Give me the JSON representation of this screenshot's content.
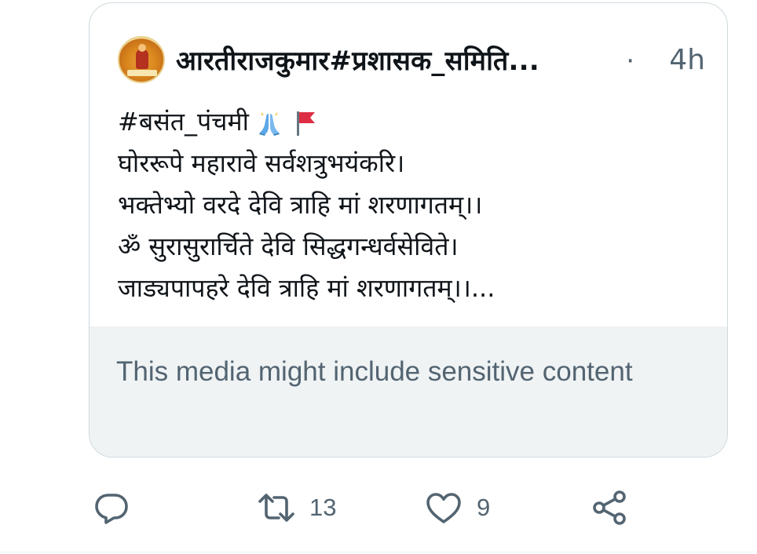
{
  "quoted_tweet": {
    "author_display_name": "आरतीराजकुमार#प्रशासक_समिति...",
    "separator": "·",
    "time_ago": "4h",
    "text_lines": [
      "#बसंत_पंचमी",
      "घोररूपे महारावे सर्वशत्रुभयंकरि।",
      "भक्तेभ्यो वरदे देवि त्राहि मां शरणागतम्।।",
      "ॐ सुरासुरार्चिते देवि सिद्धगन्धर्वसेविते।",
      "जाड्यपापहरे देवि त्राहि मां शरणागतम्।।..."
    ],
    "emojis": [
      "folded-hands",
      "red-flag"
    ],
    "sensitive_media_notice": "This media might include sensitive content"
  },
  "actions": {
    "reply_count": "",
    "retweet_count": "13",
    "like_count": "9"
  },
  "colors": {
    "text_primary": "#0f1419",
    "text_secondary": "#536471",
    "card_border": "#cfd9de",
    "sensitive_bg": "#eff3f4",
    "icon": "#536471"
  }
}
